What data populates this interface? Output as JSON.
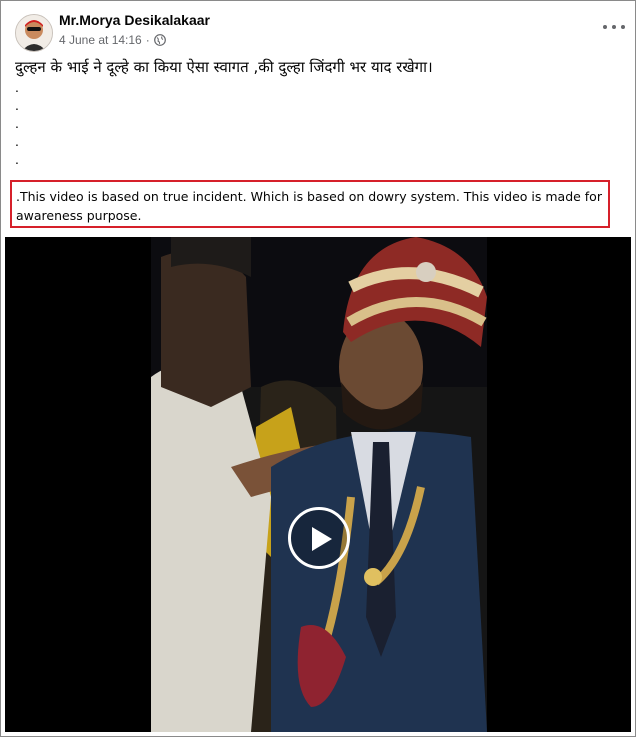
{
  "post": {
    "author": "Mr.Morya Desikalakaar",
    "date": "4 June at 14:16",
    "separator": "·",
    "caption": "दुल्हन के भाई ने दूल्हे का किया ऐसा स्वागत ,की दुल्हा जिंदगी भर याद रखेगा।",
    "dots": [
      ".",
      ".",
      ".",
      ".",
      "."
    ],
    "highlight_text": ".This video is based on true incident.  Which is based on dowry system.  This video is made for awareness purpose."
  },
  "icons": {
    "privacy": "globe-icon",
    "more": "more-options-icon",
    "play": "play-icon"
  },
  "colors": {
    "highlight_border": "#d6202a",
    "meta_text": "#65676b",
    "video_bg": "#000000"
  }
}
